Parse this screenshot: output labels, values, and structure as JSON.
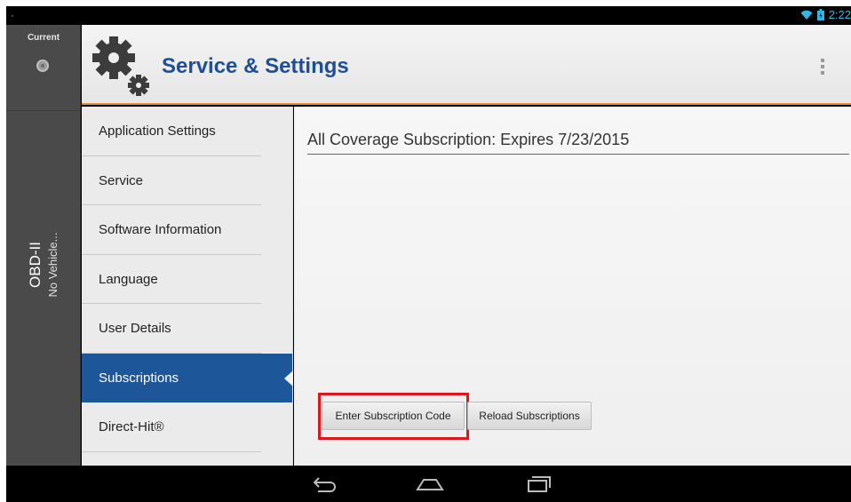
{
  "status_bar": {
    "time": "2:22"
  },
  "vehicle": {
    "current_label": "Current",
    "protocol": "OBD-II",
    "vehicle_name": "No Vehicle..."
  },
  "header": {
    "title": "Service & Settings",
    "icon": "gears-icon"
  },
  "nav": {
    "items": [
      {
        "label": "Application Settings"
      },
      {
        "label": "Service"
      },
      {
        "label": "Software Information"
      },
      {
        "label": "Language"
      },
      {
        "label": "User Details"
      },
      {
        "label": "Subscriptions"
      },
      {
        "label": "Direct-Hit®"
      }
    ],
    "active": "Subscriptions"
  },
  "content": {
    "subscription_text": "All Coverage Subscription: Expires 7/23/2015",
    "enter_code_label": "Enter Subscription Code",
    "reload_label": "Reload Subscriptions"
  },
  "colors": {
    "accent": "#1e5799",
    "title": "#1e4f96",
    "header_rule": "#e8902e",
    "highlight": "#e0161e"
  },
  "system_nav": [
    "back-icon",
    "home-icon",
    "recent-apps-icon"
  ]
}
